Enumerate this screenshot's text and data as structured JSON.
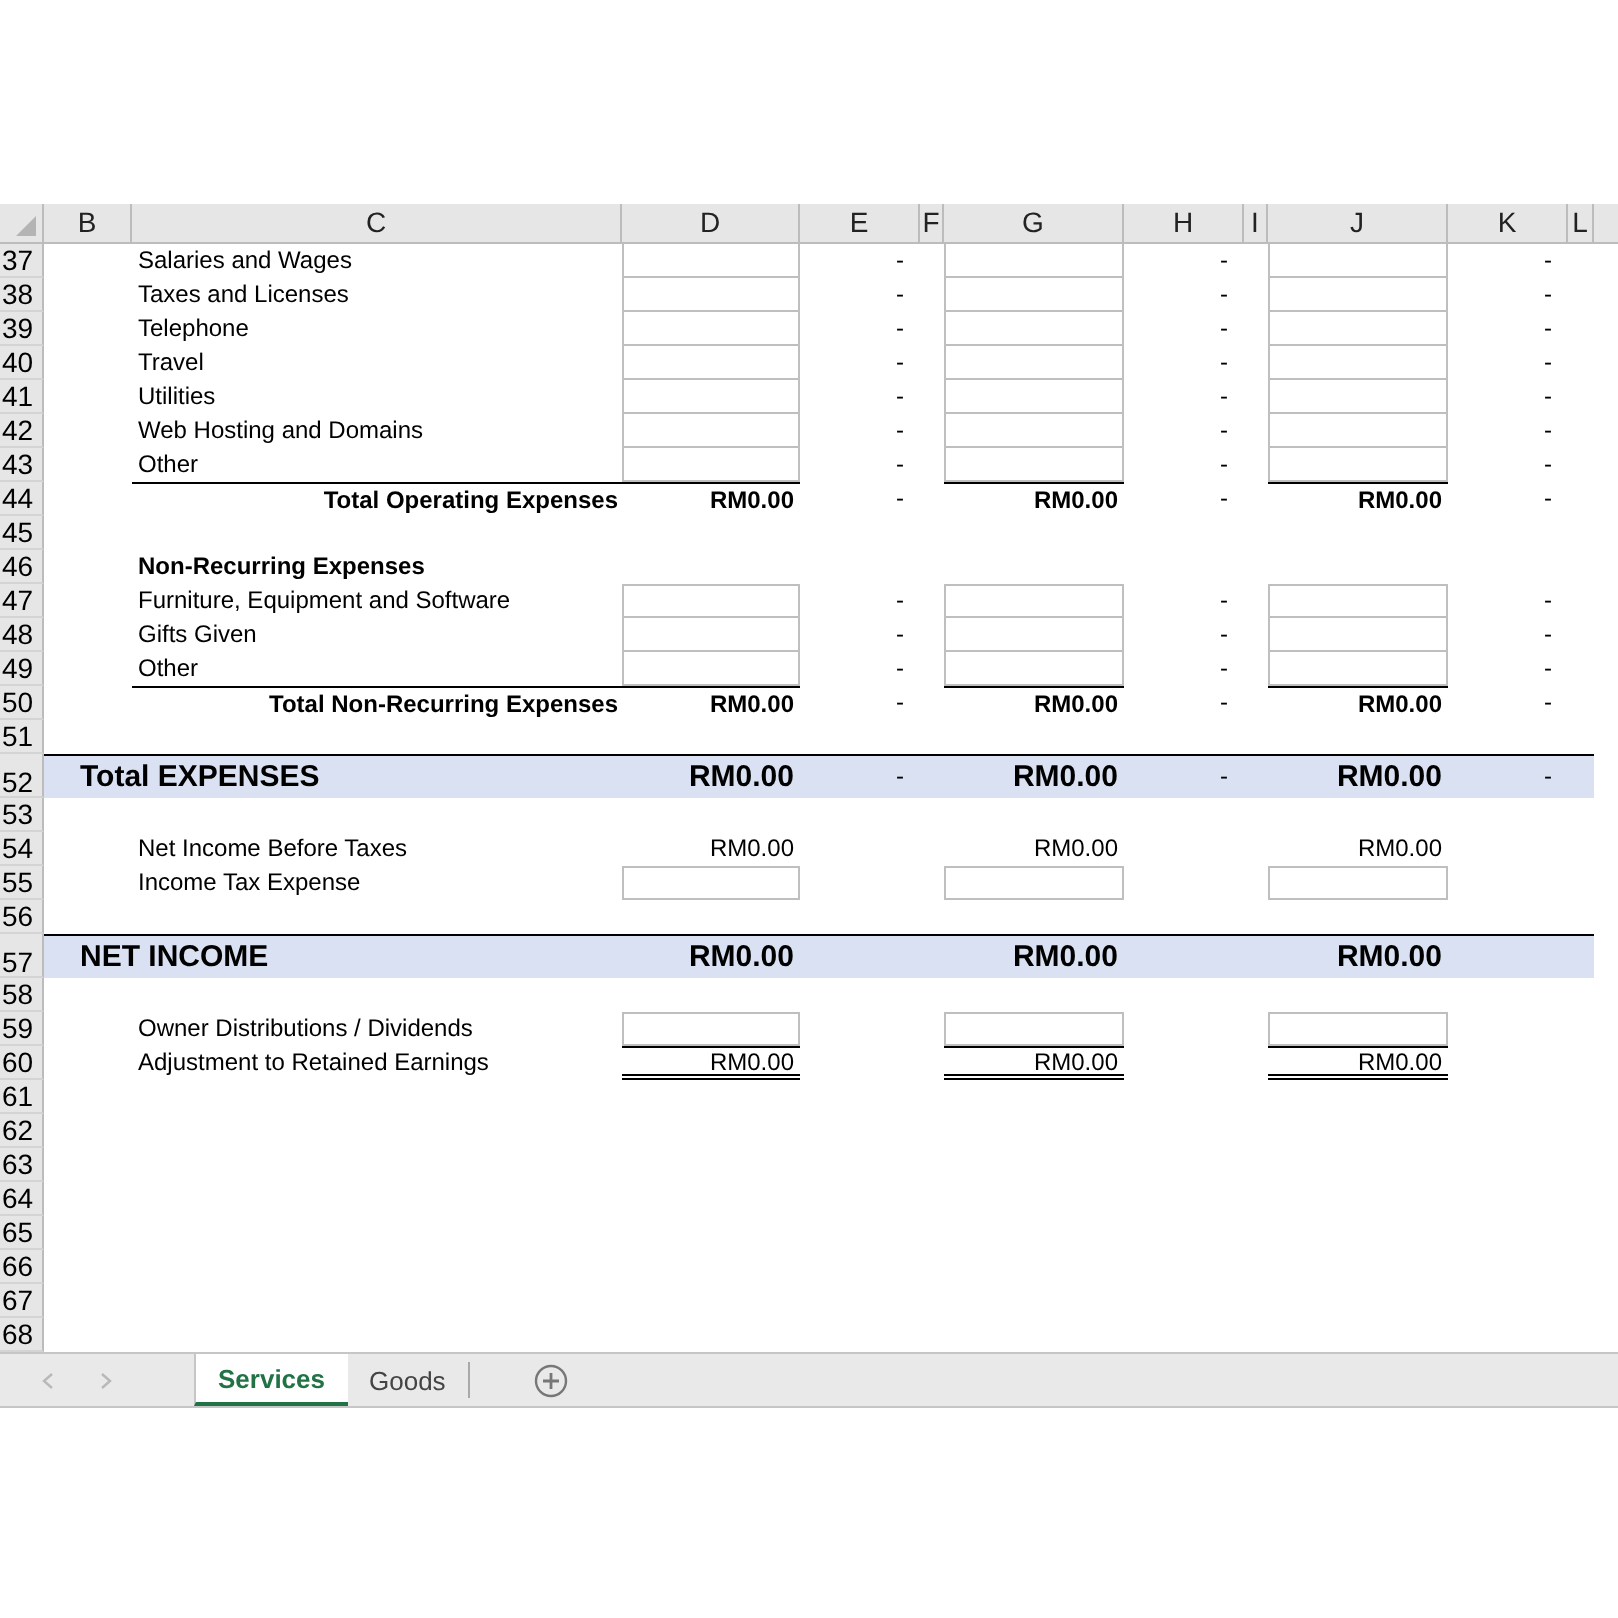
{
  "columns": [
    "B",
    "C",
    "D",
    "E",
    "F",
    "G",
    "H",
    "I",
    "J",
    "K",
    "L"
  ],
  "rows": [
    {
      "number": "37",
      "kind": "item",
      "label": "Salaries and Wages",
      "dashes": [
        "-",
        "-",
        "-"
      ]
    },
    {
      "number": "38",
      "kind": "item",
      "label": "Taxes and Licenses",
      "dashes": [
        "-",
        "-",
        "-"
      ]
    },
    {
      "number": "39",
      "kind": "item",
      "label": "Telephone",
      "dashes": [
        "-",
        "-",
        "-"
      ]
    },
    {
      "number": "40",
      "kind": "item",
      "label": "Travel",
      "dashes": [
        "-",
        "-",
        "-"
      ]
    },
    {
      "number": "41",
      "kind": "item",
      "label": "Utilities",
      "dashes": [
        "-",
        "-",
        "-"
      ]
    },
    {
      "number": "42",
      "kind": "item",
      "label": "Web Hosting and Domains",
      "dashes": [
        "-",
        "-",
        "-"
      ]
    },
    {
      "number": "43",
      "kind": "item",
      "label": "Other",
      "dashes": [
        "-",
        "-",
        "-"
      ]
    },
    {
      "number": "44",
      "kind": "total",
      "label": "Total Operating Expenses",
      "values": [
        "RM0.00",
        "RM0.00",
        "RM0.00"
      ],
      "dashes": [
        "-",
        "-",
        "-"
      ]
    },
    {
      "number": "45",
      "kind": "blank"
    },
    {
      "number": "46",
      "kind": "heading",
      "label": "Non-Recurring Expenses"
    },
    {
      "number": "47",
      "kind": "item",
      "label": "Furniture, Equipment and Software",
      "dashes": [
        "-",
        "-",
        "-"
      ]
    },
    {
      "number": "48",
      "kind": "item",
      "label": "Gifts Given",
      "dashes": [
        "-",
        "-",
        "-"
      ]
    },
    {
      "number": "49",
      "kind": "item",
      "label": "Other",
      "dashes": [
        "-",
        "-",
        "-"
      ]
    },
    {
      "number": "50",
      "kind": "total",
      "label": "Total Non-Recurring Expenses",
      "values": [
        "RM0.00",
        "RM0.00",
        "RM0.00"
      ],
      "dashes": [
        "-",
        "-",
        "-"
      ]
    },
    {
      "number": "51",
      "kind": "blank"
    },
    {
      "number": "52",
      "kind": "grand",
      "label": "Total EXPENSES",
      "values": [
        "RM0.00",
        "RM0.00",
        "RM0.00"
      ],
      "dashes": [
        "-",
        "-",
        "-"
      ]
    },
    {
      "number": "53",
      "kind": "blank"
    },
    {
      "number": "54",
      "kind": "value",
      "label": "Net Income Before Taxes",
      "values": [
        "RM0.00",
        "RM0.00",
        "RM0.00"
      ]
    },
    {
      "number": "55",
      "kind": "input",
      "label": "Income Tax Expense"
    },
    {
      "number": "56",
      "kind": "blank"
    },
    {
      "number": "57",
      "kind": "grand",
      "label": "NET INCOME",
      "values": [
        "RM0.00",
        "RM0.00",
        "RM0.00"
      ]
    },
    {
      "number": "58",
      "kind": "blank"
    },
    {
      "number": "59",
      "kind": "input",
      "label": "Owner Distributions / Dividends"
    },
    {
      "number": "60",
      "kind": "double",
      "label": "Adjustment to Retained Earnings",
      "values": [
        "RM0.00",
        "RM0.00",
        "RM0.00"
      ]
    },
    {
      "number": "61",
      "kind": "blank"
    },
    {
      "number": "62",
      "kind": "blank"
    },
    {
      "number": "63",
      "kind": "blank"
    },
    {
      "number": "64",
      "kind": "blank"
    },
    {
      "number": "65",
      "kind": "blank"
    },
    {
      "number": "66",
      "kind": "blank"
    },
    {
      "number": "67",
      "kind": "blank"
    },
    {
      "number": "68",
      "kind": "blank"
    }
  ],
  "tabs": [
    {
      "label": "Services",
      "selected": true
    },
    {
      "label": "Goods",
      "selected": false
    }
  ]
}
